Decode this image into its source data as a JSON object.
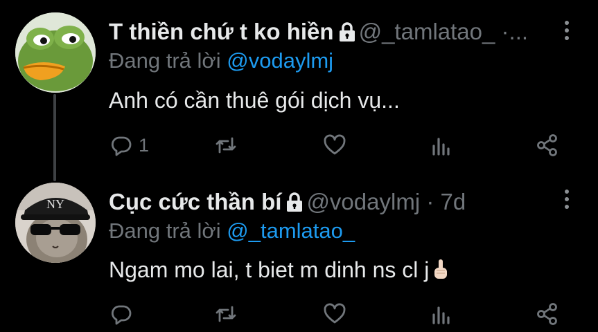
{
  "tweets": [
    {
      "display_name": "T thiền chứ t ko hiền",
      "handle": "@_tamlatao_",
      "separator": "·...",
      "replying_prefix": "Đang trả lời",
      "replying_to": "@vodaylmj",
      "text": "Anh có cần thuê gói dịch vụ...",
      "reply_count": "1",
      "avatar": "frog-avatar",
      "icons": [
        "lock-icon",
        "more-icon",
        "reply-icon",
        "retweet-icon",
        "like-icon",
        "stats-icon",
        "share-icon"
      ]
    },
    {
      "display_name": "Cục cức thần bí",
      "handle": "@vodaylmj",
      "separator": "·",
      "time": "7d",
      "replying_prefix": "Đang trả lời",
      "replying_to": "@_tamlatao_",
      "text": "Ngam mo lai, t biet m dinh ns cl j",
      "reply_count": "",
      "avatar": "cat-sunglasses-avatar",
      "emoji": "middle-finger-emoji"
    }
  ],
  "colors": {
    "background": "#000000",
    "text": "#e7e9ea",
    "muted": "#71767b",
    "link": "#1d9bf0",
    "thread_line": "#3e4144"
  }
}
